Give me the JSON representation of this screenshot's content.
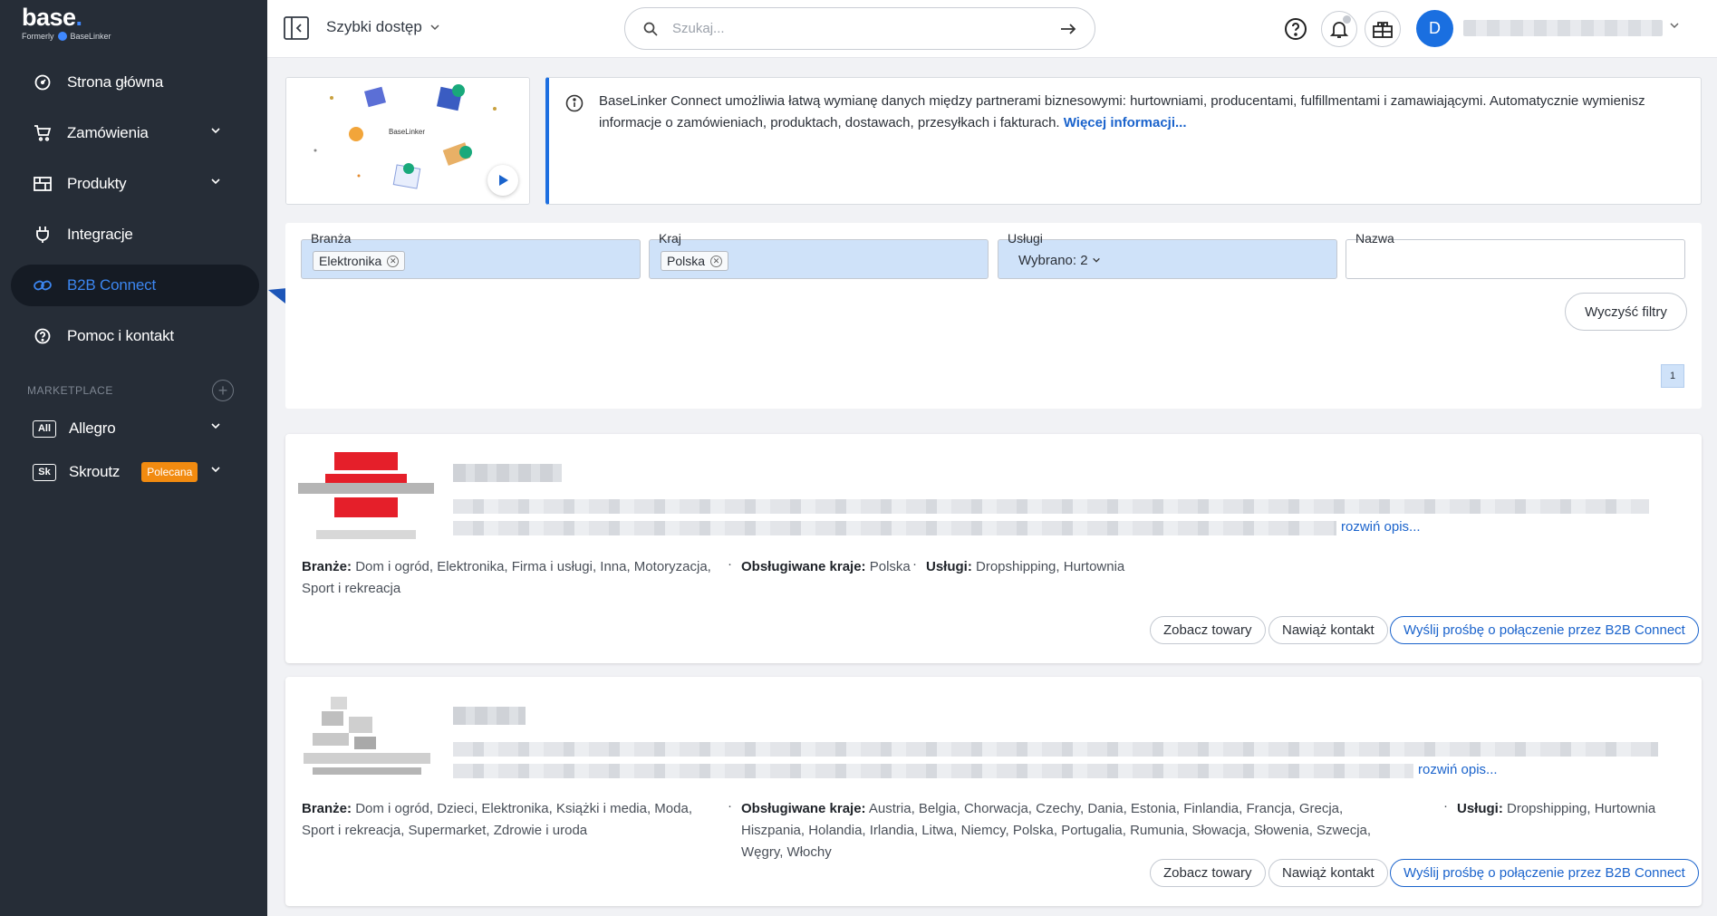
{
  "brand": {
    "logo": "base",
    "formerly": "Formerly",
    "bl_name": "BaseLinker"
  },
  "sidebar": {
    "items": [
      {
        "label": "Strona główna",
        "icon": "dashboard-icon",
        "chevron": false
      },
      {
        "label": "Zamówienia",
        "icon": "cart-icon",
        "chevron": true
      },
      {
        "label": "Produkty",
        "icon": "products-icon",
        "chevron": true
      },
      {
        "label": "Integracje",
        "icon": "plug-icon",
        "chevron": false
      },
      {
        "label": "B2B Connect",
        "icon": "link-icon",
        "chevron": false,
        "active": true
      },
      {
        "label": "Pomoc i kontakt",
        "icon": "help-icon",
        "chevron": false
      }
    ],
    "marketplace_label": "MARKETPLACE",
    "marketplaces": [
      {
        "badge": "All",
        "label": "Allegro"
      },
      {
        "badge": "Sk",
        "label": "Skroutz",
        "tag": "Polecana"
      }
    ]
  },
  "header": {
    "quick_access": "Szybki dostęp",
    "search_placeholder": "Szukaj...",
    "avatar_letter": "D"
  },
  "info": {
    "text": "BaseLinker Connect umożliwia łatwą wymianę danych między partnerami biznesowymi: hurtowniami, producentami, fulfillmentami i zamawiającymi. Automatycznie wymienisz informacje o zamówieniach, produktach, dostawach, przesyłkach i fakturach.",
    "link": "Więcej informacji...",
    "promo_tag": "BaseLinker"
  },
  "filters": {
    "branza": {
      "label": "Branża",
      "value": "Elektronika"
    },
    "kraj": {
      "label": "Kraj",
      "value": "Polska"
    },
    "uslugi": {
      "label": "Usługi",
      "value": "Wybrano: 2"
    },
    "nazwa": {
      "label": "Nazwa",
      "value": ""
    },
    "clear": "Wyczyść filtry",
    "page": "1"
  },
  "cards": [
    {
      "expand": "rozwiń opis...",
      "branze_label": "Branże:",
      "branze": "Dom i ogród, Elektronika, Firma i usługi, Inna, Motoryzacja, Sport i rekreacja",
      "kraje_label": "Obsługiwane kraje:",
      "kraje": "Polska",
      "uslugi_label": "Usługi:",
      "uslugi": "Dropshipping, Hurtownia",
      "btn_products": "Zobacz towary",
      "btn_contact": "Nawiąż kontakt",
      "btn_connect": "Wyślij prośbę o połączenie przez B2B Connect"
    },
    {
      "expand": "rozwiń opis...",
      "branze_label": "Branże:",
      "branze": "Dom i ogród, Dzieci, Elektronika, Książki i media, Moda, Sport i rekreacja, Supermarket, Zdrowie i uroda",
      "kraje_label": "Obsługiwane kraje:",
      "kraje": "Austria, Belgia, Chorwacja, Czechy, Dania, Estonia, Finlandia, Francja, Grecja, Hiszpania, Holandia, Irlandia, Litwa, Niemcy, Polska, Portugalia, Rumunia, Słowacja, Słowenia, Szwecja, Węgry, Włochy",
      "uslugi_label": "Usługi:",
      "uslugi": "Dropshipping, Hurtownia",
      "btn_products": "Zobacz towary",
      "btn_contact": "Nawiąż kontakt",
      "btn_connect": "Wyślij prośbę o połączenie przez B2B Connect"
    }
  ],
  "colors": {
    "sidebar": "#262d37",
    "accent": "#1a63cc",
    "active": "#3c86f0",
    "filter_fill": "#cfe2f9",
    "badge": "#f28b10"
  }
}
